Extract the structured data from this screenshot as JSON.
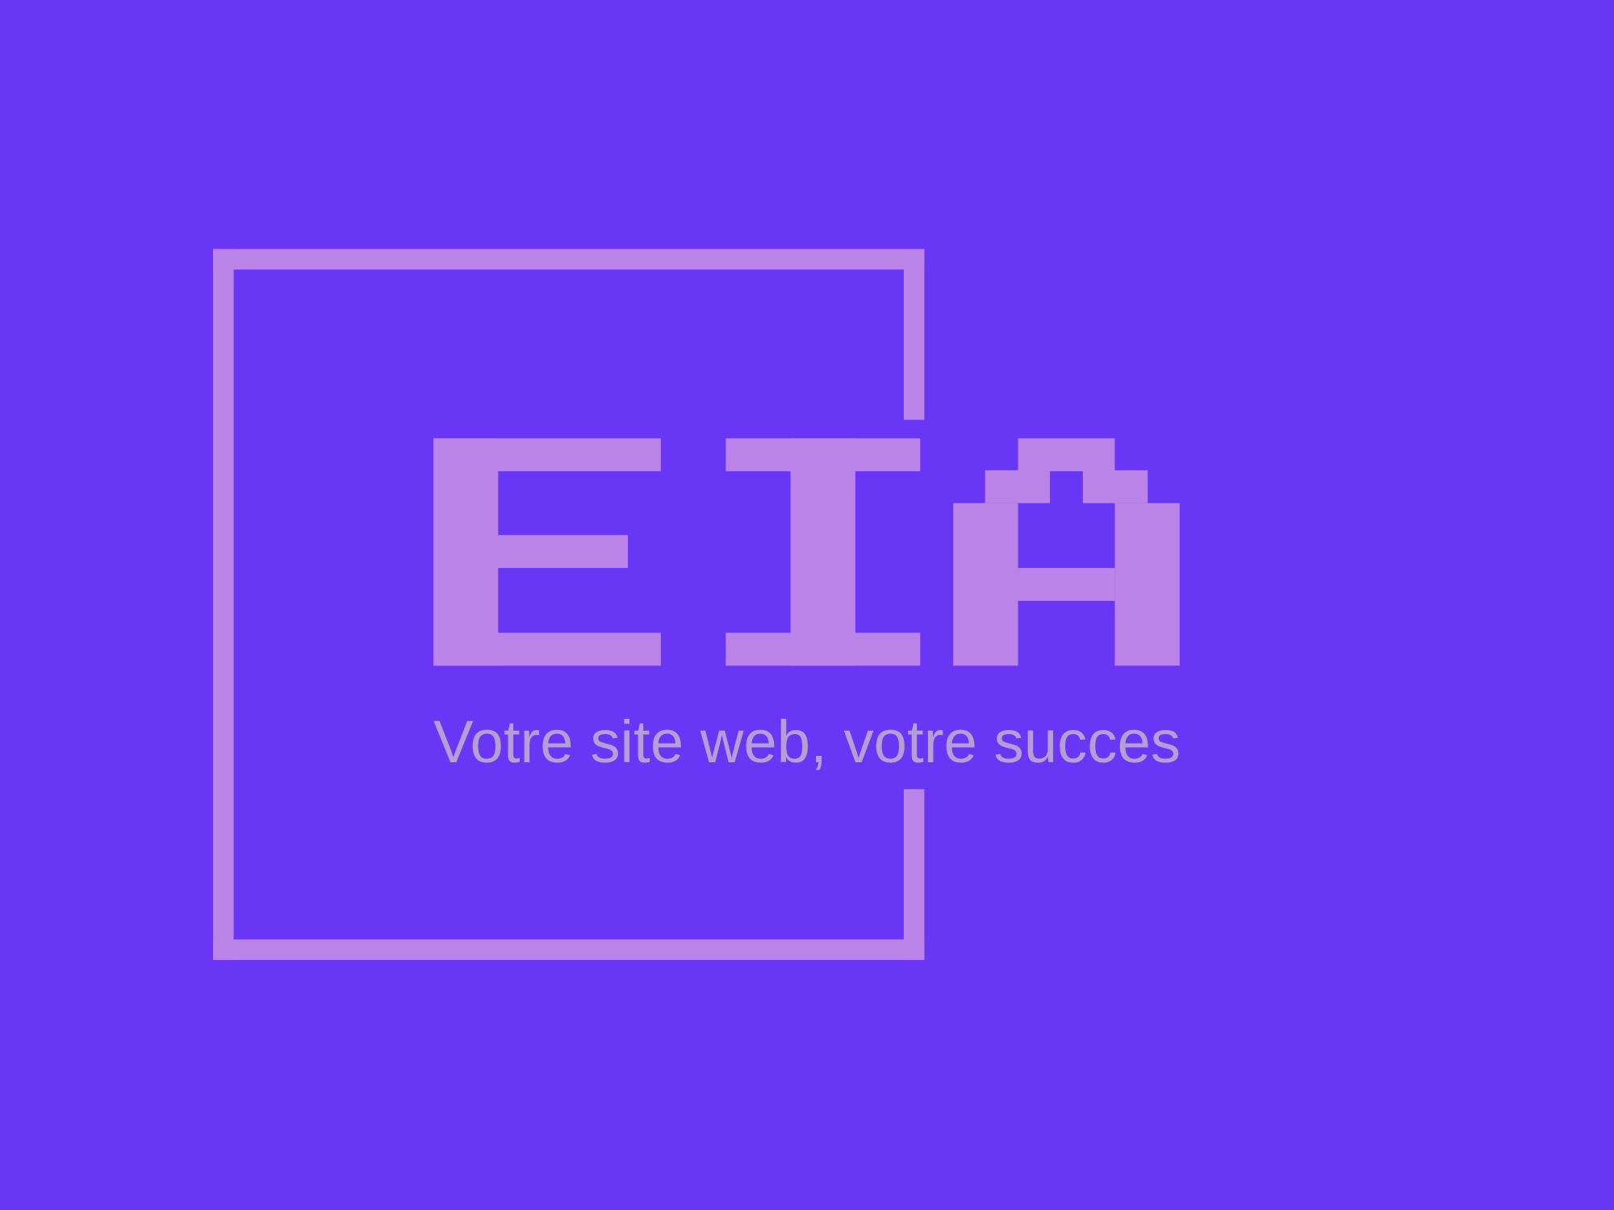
{
  "logo": {
    "wordmark": "EIA",
    "tagline": "Votre site web, votre succes"
  },
  "colors": {
    "background": "#6936f5",
    "logo": "#b983e8",
    "tagline": "#b59dd6"
  }
}
